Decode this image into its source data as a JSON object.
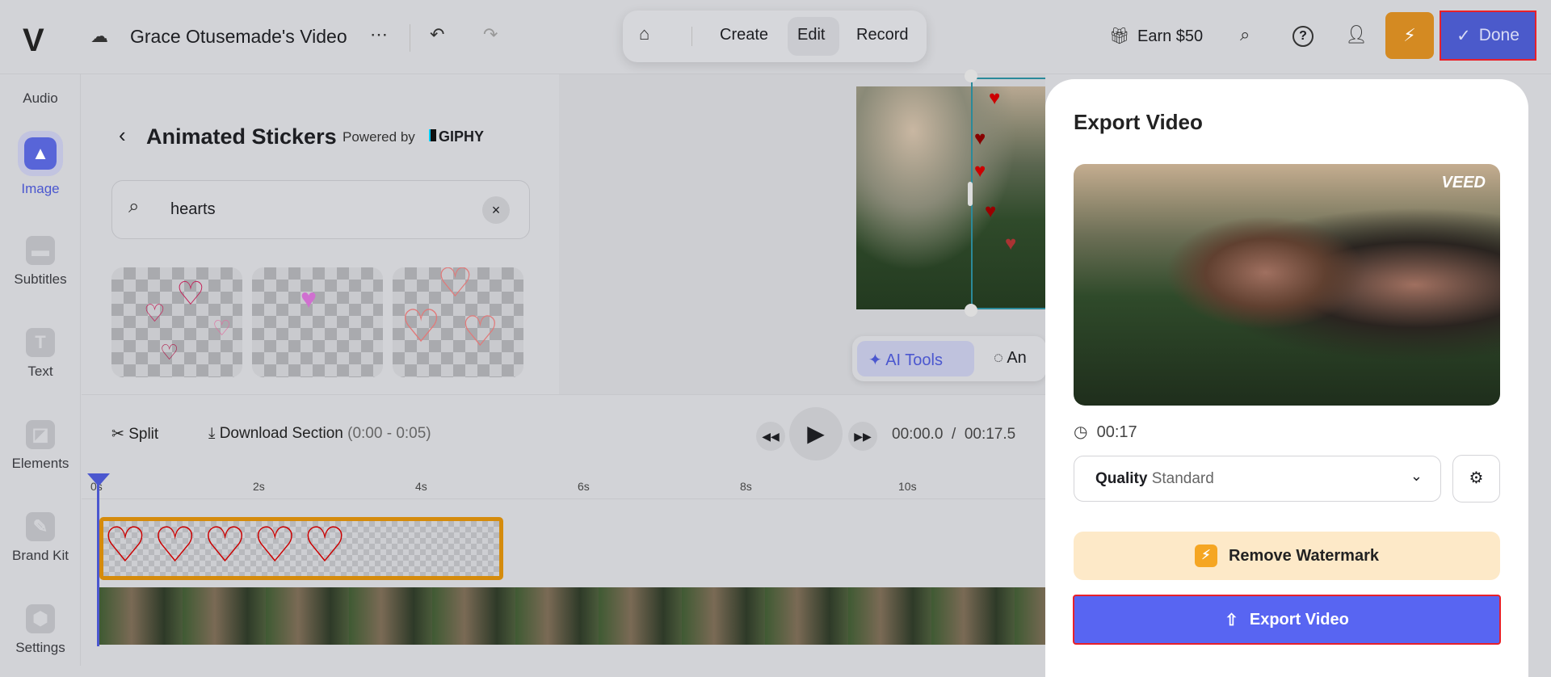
{
  "topbar": {
    "logo": "V",
    "project_title": "Grace Otusemade's Video",
    "more": "⋯",
    "undo": "↶",
    "redo": "↷",
    "home": "⌂",
    "tabs": [
      "Create",
      "Edit",
      "Record"
    ],
    "active_tab": "Edit",
    "earn": "Earn $50",
    "done": "Done",
    "colors": {
      "done": "#4b5acb",
      "upgrade": "#d48a22"
    }
  },
  "sidebar": {
    "items": [
      {
        "label": "Audio"
      },
      {
        "label": "Image",
        "active": true
      },
      {
        "label": "Subtitles"
      },
      {
        "label": "Text"
      },
      {
        "label": "Elements"
      },
      {
        "label": "Brand Kit"
      },
      {
        "label": "Settings"
      }
    ]
  },
  "stickers": {
    "title": "Animated Stickers",
    "powered_by": "Powered by",
    "brand": "GIPHY",
    "search_value": "hearts"
  },
  "canvas": {
    "ai_tools": "AI Tools",
    "next_tool": "An"
  },
  "timeline": {
    "split": "Split",
    "download_section": "Download Section",
    "range": "(0:00 - 0:05)",
    "current_time": "00:00.0",
    "separator": "/",
    "total_time": "00:17.5",
    "ticks": [
      "0s",
      "2s",
      "4s",
      "6s",
      "8s",
      "10s"
    ]
  },
  "export": {
    "title": "Export Video",
    "watermark": "VEED",
    "duration": "00:17",
    "quality_label": "Quality",
    "quality_value": "Standard",
    "remove_watermark": "Remove Watermark",
    "export_button": "Export Video",
    "accent": "#5865f2"
  }
}
